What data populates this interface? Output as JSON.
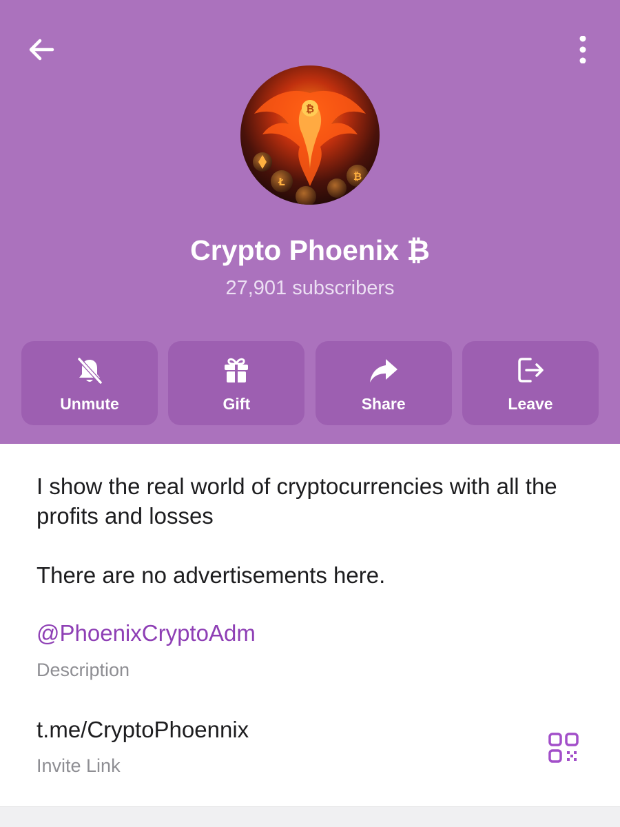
{
  "colors": {
    "header_bg": "#ab72bd",
    "action_bg": "#9d5fb1",
    "accent": "#8e3fb5",
    "text": "#1d1d1f",
    "caption": "#8e8e93"
  },
  "header": {
    "back_icon": "arrow-left-icon",
    "menu_icon": "more-vertical-icon",
    "avatar": "phoenix-bitcoin-avatar",
    "title": "Crypto Phoenix ₿",
    "subscribers": "27,901 subscribers"
  },
  "actions": [
    {
      "label": "Unmute",
      "icon": "bell-off-icon"
    },
    {
      "label": "Gift",
      "icon": "gift-icon"
    },
    {
      "label": "Share",
      "icon": "share-arrow-icon"
    },
    {
      "label": "Leave",
      "icon": "leave-icon"
    }
  ],
  "info": {
    "description_line1": "I show the real world of cryptocurrencies with all the profits and losses",
    "description_line2": "There are no advertisements here.",
    "handle": "@PhoenixCryptoAdm",
    "description_caption": "Description",
    "invite_link": "t.me/CryptoPhoennix",
    "invite_caption": "Invite Link",
    "qr_icon": "qr-code-icon"
  }
}
